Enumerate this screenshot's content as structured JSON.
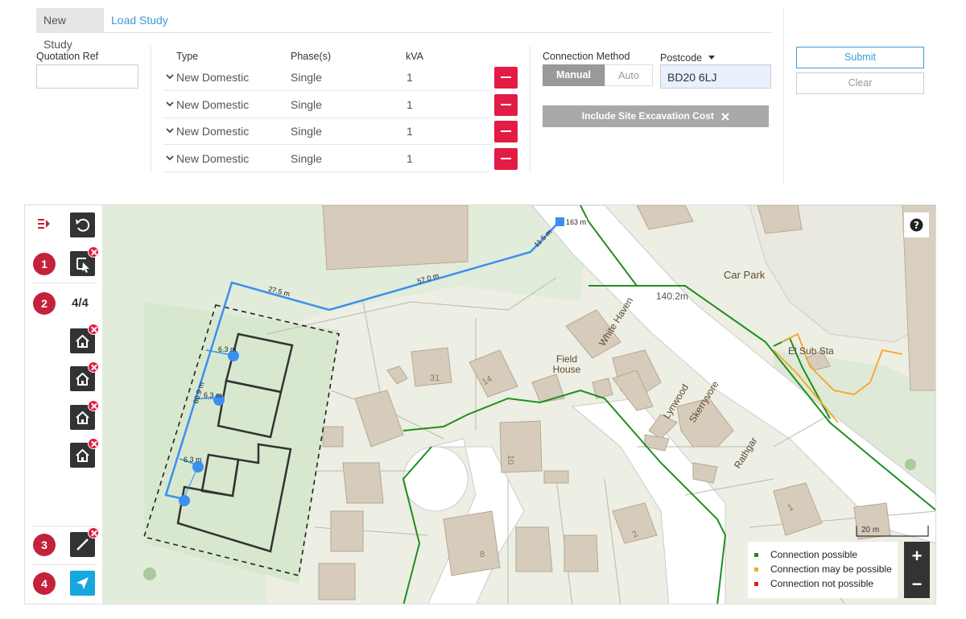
{
  "tabs": [
    {
      "label": "New Study"
    },
    {
      "label": "Load Study"
    }
  ],
  "quote": {
    "label": "Quotation Ref",
    "value": ""
  },
  "table": {
    "headers": {
      "type": "Type",
      "phase": "Phase(s)",
      "kva": "kVA"
    },
    "rows": [
      {
        "type": "New Domestic",
        "phase": "Single",
        "kva": "1"
      },
      {
        "type": "New Domestic",
        "phase": "Single",
        "kva": "1"
      },
      {
        "type": "New Domestic",
        "phase": "Single",
        "kva": "1"
      },
      {
        "type": "New Domestic",
        "phase": "Single",
        "kva": "1"
      }
    ]
  },
  "connection": {
    "label": "Connection Method",
    "manual": "Manual",
    "auto": "Auto",
    "selected": "Manual"
  },
  "postcode": {
    "label": "Postcode",
    "value": "BD20 6LJ"
  },
  "excavation": {
    "label": "Include Site Excavation Cost"
  },
  "actions": {
    "submit": "Submit",
    "clear": "Clear"
  },
  "map": {
    "steps": [
      "1",
      "2",
      "3",
      "4"
    ],
    "plot_count": "4/4",
    "labels": {
      "car_park": "Car Park",
      "elev": "140.2m",
      "sub_sta": "El Sub Sta",
      "field_house": "Field House",
      "white_haven": "White Haven",
      "lynwood": "Lynwood",
      "skerryvore": "Skerryvore",
      "rathgar": "Rathgar",
      "n31": "31",
      "n14": "14",
      "n10": "10",
      "n8": "8",
      "n2": "2",
      "n1": "1"
    },
    "measures": {
      "m1": "27.5 m",
      "m2": "57.0 m",
      "m3": "11.5 m",
      "m4": "163 m",
      "m5": "6.3 m",
      "m6": "6.3 m",
      "m7": "6.3 m",
      "m8": "60.9 m"
    },
    "scale": "20 m",
    "legend": [
      {
        "label": "Connection possible",
        "color": "#1e8f1e"
      },
      {
        "label": "Connection may be possible",
        "color": "#f5a623"
      },
      {
        "label": "Connection not possible",
        "color": "#e31b1b"
      }
    ],
    "zoom_in": "+",
    "zoom_out": "−"
  }
}
